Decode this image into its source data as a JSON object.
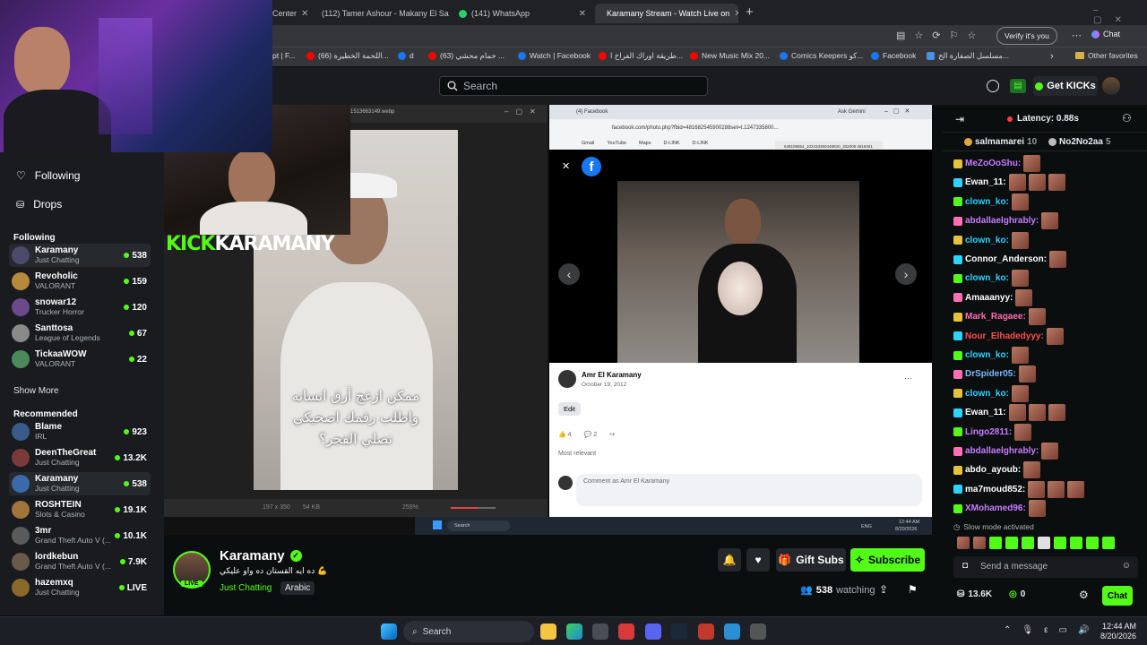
{
  "browser": {
    "tabs": [
      {
        "label": "Center"
      },
      {
        "label": "(112) Tamer Ashour - Makany El Sa"
      },
      {
        "label": "(141) WhatsApp"
      },
      {
        "label": "Karamany Stream - Watch Live on"
      }
    ],
    "verify_label": "Verify it's you",
    "copilot_label": "Chat",
    "bookmarks": [
      "pt | F...",
      "(66) اللحمة الخطيرة...",
      "d",
      "(63) حمام محشي ...",
      "Watch | Facebook",
      "طريقة اوراك الفراخ ا...",
      "New Music Mix 20...",
      "Comics Keepers كو...",
      "Facebook",
      "مسلسل الصفارة الح..."
    ],
    "other_favorites": "Other favorites"
  },
  "kick": {
    "search_placeholder": "Search",
    "get_kicks": "Get KICKs",
    "brand_color": "#53fc18"
  },
  "sidebar": {
    "nav": [
      {
        "label": "Following"
      },
      {
        "label": "Drops"
      }
    ],
    "following_header": "Following",
    "following": [
      {
        "name": "Karamany",
        "category": "Just Chatting",
        "viewers": "538"
      },
      {
        "name": "Revoholic",
        "category": "VALORANT",
        "viewers": "159"
      },
      {
        "name": "snowar12",
        "category": "Trucker Horror",
        "viewers": "120"
      },
      {
        "name": "Santtosa",
        "category": "League of Legends",
        "viewers": "67"
      },
      {
        "name": "TickaaWOW",
        "category": "VALORANT",
        "viewers": "22"
      }
    ],
    "show_more": "Show More",
    "recommended_header": "Recommended",
    "recommended": [
      {
        "name": "Blame",
        "category": "IRL",
        "viewers": "923"
      },
      {
        "name": "DeenTheGreat",
        "category": "Just Chatting",
        "viewers": "13.2K"
      },
      {
        "name": "Karamany",
        "category": "Just Chatting",
        "viewers": "538"
      },
      {
        "name": "ROSHTEIN",
        "category": "Slots & Casino",
        "viewers": "19.1K"
      },
      {
        "name": "3mr",
        "category": "Grand Theft Auto V (...",
        "viewers": "10.1K"
      },
      {
        "name": "lordkebun",
        "category": "Grand Theft Auto V (...",
        "viewers": "7.9K"
      },
      {
        "name": "hazemxq",
        "category": "Just Chatting",
        "viewers": "LIVE"
      }
    ]
  },
  "video": {
    "overlay_logo": "KICK",
    "overlay_name": "KARAMANY",
    "image_tab_title": "1513663149.webp",
    "arabic_caption": [
      "ممكن ازعج أرق انسانه",
      "واطلب رقمك اصحيكي",
      "تصلي الفجر؟"
    ],
    "fb_tab": "(4) Facebook",
    "fb_url": "facebook.com/photo.php?fbid=481682545900288set=t.1247335800...",
    "ask_gemini": "Ask Gemini",
    "download_file": "648108864_102433350448830_302008 381846176628_n.jpg",
    "fb_bookmarks": [
      "Gmail",
      "YouTube",
      "Maps",
      "D-LINK",
      "D-LINK"
    ],
    "post_author": "Amr El Karamany",
    "post_date": "October 19, 2012",
    "edit_label": "Edit",
    "likes": "4",
    "comments": "2",
    "most_relevant": "Most relevant",
    "comment_placeholder": "Comment as Amr El Karamany",
    "zoom": "259%",
    "img_dims": "197 x 350",
    "img_size": "54 KB",
    "inner_search": "Search",
    "inner_lang": "ENG",
    "inner_time": "12:44 AM",
    "inner_date": "8/20/2026"
  },
  "stream": {
    "streamer": "Karamany",
    "title": "ده ايه القستان ده واو عليكي 💪",
    "category": "Just Chatting",
    "tag": "Arabic",
    "live_label": "LIVE",
    "gift_subs": "Gift Subs",
    "subscribe": "Subscribe",
    "viewers": "538",
    "watching_label": "watching"
  },
  "chat": {
    "latency": "Latency: 0.88s",
    "pinned": [
      {
        "user": "salmamarei",
        "count": "10"
      },
      {
        "user": "No2No2aa",
        "count": "5"
      }
    ],
    "messages": [
      {
        "user": "MeZoOoShu:",
        "color": "#c87cff",
        "emotes": 1
      },
      {
        "user": "Ewan_11:",
        "color": "#ffffff",
        "emotes": 3
      },
      {
        "user": "clown_ko:",
        "color": "#2dd4ff",
        "emotes": 1
      },
      {
        "user": "abdallaelghrably:",
        "color": "#c87cff",
        "emotes": 1
      },
      {
        "user": "clown_ko:",
        "color": "#2dd4ff",
        "emotes": 1
      },
      {
        "user": "Connor_Anderson:",
        "color": "#ffffff",
        "emotes": 1
      },
      {
        "user": "clown_ko:",
        "color": "#2dd4ff",
        "emotes": 1
      },
      {
        "user": "Amaaanyy:",
        "color": "#ffffff",
        "emotes": 1
      },
      {
        "user": "Mark_Ragaee:",
        "color": "#ff6fb2",
        "emotes": 1
      },
      {
        "user": "Nour_Elhadedyyy:",
        "color": "#ff4d4d",
        "emotes": 1
      },
      {
        "user": "clown_ko:",
        "color": "#2dd4ff",
        "emotes": 1
      },
      {
        "user": "DrSpider05:",
        "color": "#7ab8ff",
        "emotes": 1
      },
      {
        "user": "clown_ko:",
        "color": "#2dd4ff",
        "emotes": 1
      },
      {
        "user": "Ewan_11:",
        "color": "#ffffff",
        "emotes": 3
      },
      {
        "user": "Lingo2811:",
        "color": "#c87cff",
        "emotes": 1
      },
      {
        "user": "abdallaelghrably:",
        "color": "#c87cff",
        "emotes": 1
      },
      {
        "user": "abdo_ayoub:",
        "color": "#ffffff",
        "emotes": 1
      },
      {
        "user": "ma7moud852:",
        "color": "#ffffff",
        "emotes": 3
      },
      {
        "user": "XMohamed96:",
        "color": "#c87cff",
        "emotes": 1
      }
    ],
    "slow_mode": "Slow mode activated",
    "input_placeholder": "Send a message",
    "kicks": "13.6K",
    "points": "0",
    "chat_button": "Chat"
  },
  "taskbar": {
    "search": "Search",
    "time": "12:44 AM",
    "date": "8/20/2026"
  }
}
